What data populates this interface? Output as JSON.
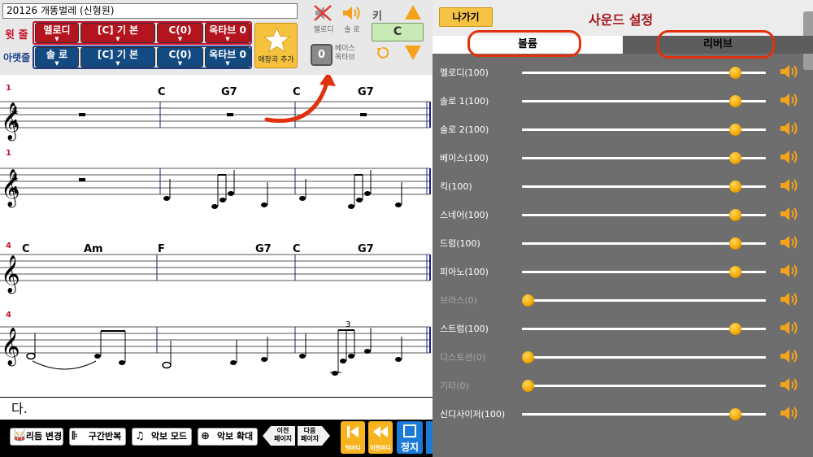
{
  "song": {
    "title": "20126  개똥벌레 (신형원)"
  },
  "controls": {
    "upper_label": "윗 줄",
    "lower_label": "아랫줄",
    "upper": {
      "instrument": "멜로디",
      "key_mode": "[C] 기  본",
      "transpose": "C(0)",
      "octave": "옥타브 0"
    },
    "lower": {
      "instrument": "솔 로",
      "key_mode": "[C] 기  본",
      "transpose": "C(0)",
      "octave": "옥타브 0"
    },
    "fav_label": "애창곡 추가",
    "melody_label": "멜로디",
    "solo_label": "솔 로",
    "bass_octave_value": "0",
    "bass_octave_label": "베이스\n옥타브",
    "key_label": "키",
    "key_value": "C"
  },
  "score": {
    "system1": {
      "measure_number": "1",
      "chords": [
        "C",
        "G7",
        "C",
        "G7"
      ]
    },
    "system2": {
      "measure_number": "4",
      "chords": [
        "C",
        "Am",
        "F",
        "G7",
        "C",
        "G7"
      ]
    },
    "triplet_label": "3"
  },
  "lyrics": {
    "text": "다."
  },
  "toolbar": {
    "rhythm": "리듬 변경",
    "repeat": "구간반복",
    "score_mode": "악보 모드",
    "zoom": "악보 확대",
    "prev_page_1": "이전",
    "prev_page_2": "페이지",
    "next_page_1": "다음",
    "next_page_2": "페이지",
    "first_bar": "첫마디",
    "prev_bar": "이전마디",
    "stop": "정지"
  },
  "panel": {
    "back": "나가기",
    "title": "사운드 설정",
    "tab_volume": "볼륨",
    "tab_reverb": "리버브",
    "channels": [
      {
        "label": "멜로디(100)",
        "value": 100,
        "muted": false
      },
      {
        "label": "솔로 1(100)",
        "value": 100,
        "muted": false
      },
      {
        "label": "솔로 2(100)",
        "value": 100,
        "muted": false
      },
      {
        "label": "베이스(100)",
        "value": 100,
        "muted": false
      },
      {
        "label": "킥(100)",
        "value": 100,
        "muted": false
      },
      {
        "label": "스네어(100)",
        "value": 100,
        "muted": false
      },
      {
        "label": "드럼(100)",
        "value": 100,
        "muted": false
      },
      {
        "label": "피아노(100)",
        "value": 100,
        "muted": false
      },
      {
        "label": "브라스(0)",
        "value": 0,
        "muted": true
      },
      {
        "label": "스트럼(100)",
        "value": 100,
        "muted": false
      },
      {
        "label": "디스토션(0)",
        "value": 0,
        "muted": true
      },
      {
        "label": "기타(0)",
        "value": 0,
        "muted": true
      },
      {
        "label": "신디사이저(100)",
        "value": 100,
        "muted": false
      }
    ]
  },
  "colors": {
    "accent_red": "#b3141e",
    "accent_blue": "#134a82",
    "highlight": "#e0320f",
    "gold": "#f6c23e"
  }
}
